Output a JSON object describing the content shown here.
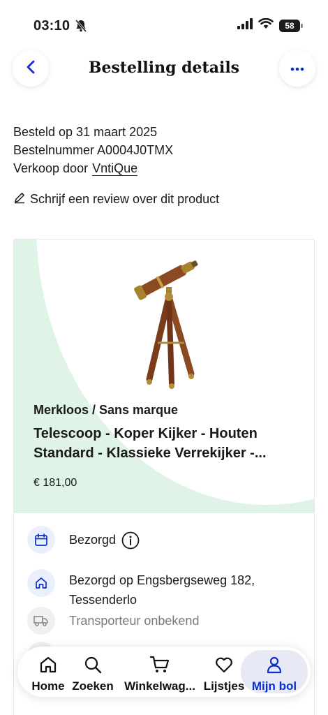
{
  "status_bar": {
    "time": "03:10",
    "battery": "58"
  },
  "header": {
    "title": "Bestelling details"
  },
  "order": {
    "ordered_on": "Besteld op 31 maart 2025",
    "order_number": "Bestelnummer A0004J0TMX",
    "sold_by_label": "Verkoop door",
    "seller": "VntiQue"
  },
  "review_link": "Schrijf een review over dit product",
  "product": {
    "brand": "Merkloos / Sans marque",
    "name": "Telescoop - Koper Kijker - Houten Standard - Klassieke Verrekijker -...",
    "price": "€ 181,00"
  },
  "status": {
    "delivered": "Bezorgd",
    "address": "Bezorgd op Engsbergseweg 182, Tessenderlo",
    "carrier": "Transporteur onbekend"
  },
  "nav": {
    "items": [
      {
        "label": "Home",
        "icon": "home-icon"
      },
      {
        "label": "Zoeken",
        "icon": "search-icon"
      },
      {
        "label": "Winkelwag...",
        "icon": "cart-icon"
      },
      {
        "label": "Lijstjes",
        "icon": "heart-icon"
      },
      {
        "label": "Mijn bol",
        "icon": "user-icon"
      }
    ],
    "active_index": 4
  },
  "colors": {
    "accent": "#0c2ecb",
    "card_green": "#dff3e7",
    "icon_bg": "#eaf0fb"
  }
}
